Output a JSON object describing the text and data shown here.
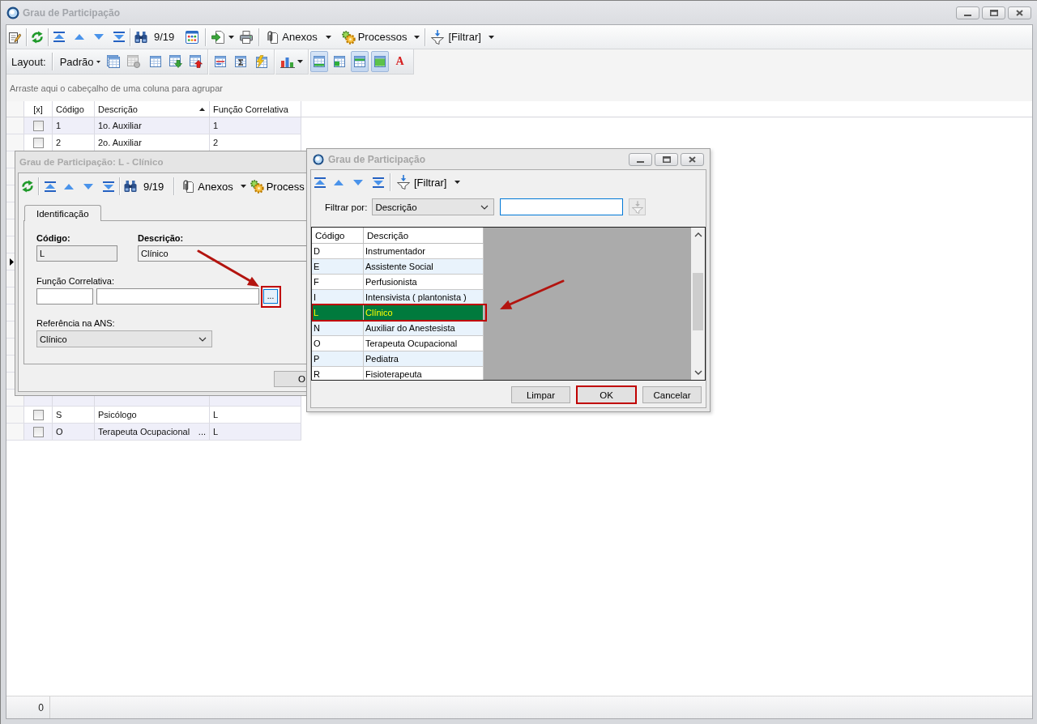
{
  "window": {
    "title": "Grau de Participação"
  },
  "toolbar": {
    "record_counter": "9/19",
    "attachments_button": "Anexos",
    "processes_button": "Processos",
    "filter_button": "[Filtrar]"
  },
  "layout_bar": {
    "label": "Layout:",
    "layout_dropdown": "Padrão",
    "view_toggles": [
      {
        "pressed": true
      },
      {
        "pressed": false
      },
      {
        "pressed": true
      },
      {
        "pressed": true
      },
      {
        "label": "A",
        "pressed": false
      }
    ]
  },
  "group_panel": {
    "hint": "Arraste aqui o cabeçalho de uma coluna para agrupar"
  },
  "grid": {
    "columns": [
      {
        "label": "[x]",
        "sorted": false
      },
      {
        "label": "Código",
        "sorted": false
      },
      {
        "label": "Descrição",
        "sorted": true
      },
      {
        "label": "Função Correlativa",
        "sorted": false
      }
    ],
    "current_row_marker": true,
    "rows_above_dialog": [
      {
        "checked": false,
        "code": "1",
        "description": "1o. Auxiliar",
        "correlative_function": "1"
      },
      {
        "checked": false,
        "code": "2",
        "description": "2o. Auxiliar",
        "correlative_function": "2"
      }
    ],
    "rows_below_dialog": [
      {
        "checked": false,
        "code": "S",
        "description": "Psicólogo",
        "correlative_function": "L"
      },
      {
        "checked": false,
        "code": "O",
        "description": "Terapeuta Ocupacional",
        "description_suffix": "...",
        "correlative_function": "L"
      }
    ]
  },
  "status_bar": {
    "record_count": "0"
  },
  "record_dialog": {
    "title": "Grau de Participação: L - Clínico",
    "toolbar": {
      "record_counter": "9/19",
      "attachments_button": "Anexos",
      "processes_button": "Process"
    },
    "tabs": [
      {
        "label": "Identificação",
        "selected": true
      }
    ],
    "code": {
      "label": "Código:",
      "value": "L"
    },
    "description": {
      "label": "Descrição:",
      "value": "Clínico"
    },
    "correlative_function": {
      "label": "Função Correlativa:",
      "lookup_button": {
        "label": "...",
        "highlighted": true,
        "arrow": true
      }
    },
    "ans_reference": {
      "label": "Referência na ANS:",
      "value": "Clínico"
    },
    "buttons": [
      "O"
    ]
  },
  "lookup_dialog": {
    "title": "Grau de Participação",
    "toolbar": {
      "filter_button": "[Filtrar]"
    },
    "filter_by": {
      "label": "Filtrar por:",
      "value": "Descrição"
    },
    "search_field": {
      "focused": true
    },
    "apply_filter_button": {
      "disabled": true
    },
    "grid": {
      "columns": [
        "Código",
        "Descrição"
      ],
      "rows": [
        {
          "code": "D",
          "description": "Instrumentador",
          "selected": false,
          "highlighted": false,
          "arrow": false
        },
        {
          "code": "E",
          "description": "Assistente Social",
          "selected": false,
          "highlighted": false,
          "arrow": false
        },
        {
          "code": "F",
          "description": "Perfusionista",
          "selected": false,
          "highlighted": false,
          "arrow": false
        },
        {
          "code": "I",
          "description": "Intensivista ( plantonista )",
          "selected": false,
          "highlighted": false,
          "arrow": false
        },
        {
          "code": "L",
          "description": "Clínico",
          "selected": true,
          "highlighted": true,
          "arrow": true
        },
        {
          "code": "N",
          "description": "Auxiliar do Anestesista",
          "selected": false,
          "highlighted": false,
          "arrow": false
        },
        {
          "code": "O",
          "description": "Terapeuta Ocupacional",
          "selected": false,
          "highlighted": false,
          "arrow": false
        },
        {
          "code": "P",
          "description": "Pediatra",
          "selected": false,
          "highlighted": false,
          "arrow": false
        },
        {
          "code": "R",
          "description": "Fisioterapeuta",
          "selected": false,
          "highlighted": false,
          "arrow": false
        }
      ]
    },
    "buttons": [
      {
        "label": "Limpar",
        "highlighted": false
      },
      {
        "label": "OK",
        "highlighted": true
      },
      {
        "label": "Cancelar",
        "highlighted": false
      }
    ]
  }
}
